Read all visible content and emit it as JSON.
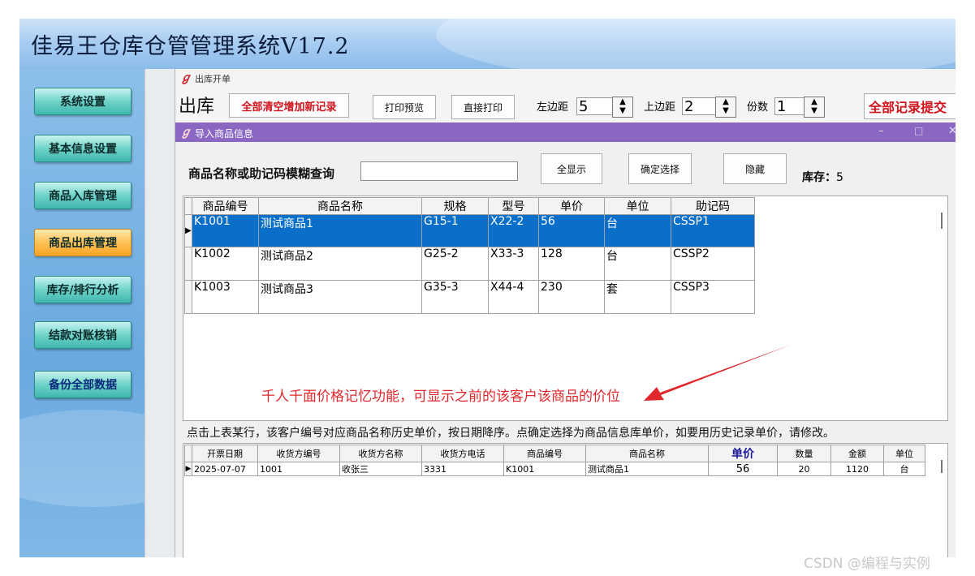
{
  "app": {
    "title": "佳易王仓库仓管管理系统V17.2"
  },
  "sidebar": {
    "items": [
      {
        "label": "系统设置"
      },
      {
        "label": "基本信息设置"
      },
      {
        "label": "商品入库管理"
      },
      {
        "label": "商品出库管理"
      },
      {
        "label": "库存/排行分析"
      },
      {
        "label": "结款对账核销"
      },
      {
        "label": "备份全部数据"
      }
    ]
  },
  "outbound": {
    "window_title": "出库开单",
    "heading": "出库",
    "clear_new_label": "全部清空增加新记录",
    "print_preview_label": "打印预览",
    "direct_print_label": "直接打印",
    "left_margin_label": "左边距",
    "left_margin_value": "5",
    "top_margin_label": "上边距",
    "top_margin_value": "2",
    "copies_label": "份数",
    "copies_value": "1",
    "submit_all_label": "全部记录提交"
  },
  "import_dialog": {
    "title": "导入商品信息",
    "search_label": "商品名称或助记码模糊查询",
    "search_value": "",
    "show_all_label": "全显示",
    "confirm_label": "确定选择",
    "hide_label": "隐藏",
    "stock_label": "库存：",
    "stock_value": "5",
    "goods_columns": [
      "商品编号",
      "商品名称",
      "规格",
      "型号",
      "单价",
      "单位",
      "助记码"
    ],
    "goods_rows": [
      [
        "K1001",
        "测试商品1",
        "G15-1",
        "X22-2",
        "56",
        "台",
        "CSSP1"
      ],
      [
        "K1002",
        "测试商品2",
        "G25-2",
        "X33-3",
        "128",
        "台",
        "CSSP2"
      ],
      [
        "K1003",
        "测试商品3",
        "G35-3",
        "X44-4",
        "230",
        "套",
        "CSSP3"
      ]
    ],
    "annotation": "千人千面价格记忆功能，可显示之前的该客户该商品的价位",
    "hint": "点击上表某行，该客户编号对应商品名称历史单价，按日期降序。点确定选择为商品信息库单价，如要用历史记录单价，请修改。",
    "history_columns": [
      "开票日期",
      "收货方编号",
      "收货方名称",
      "收货方电话",
      "商品编号",
      "商品名称",
      "单价",
      "数量",
      "金额",
      "单位"
    ],
    "history_rows": [
      [
        "2025-07-07",
        "1001",
        "收张三",
        "3331",
        "K1001",
        "测试商品1",
        "56",
        "20",
        "1120",
        "台"
      ]
    ]
  },
  "watermark": "CSDN @编程与实例",
  "colors": {
    "accent_purple": "#8a67c2",
    "selection_blue": "#0a6fc8",
    "annotation_red": "#e0282c"
  }
}
